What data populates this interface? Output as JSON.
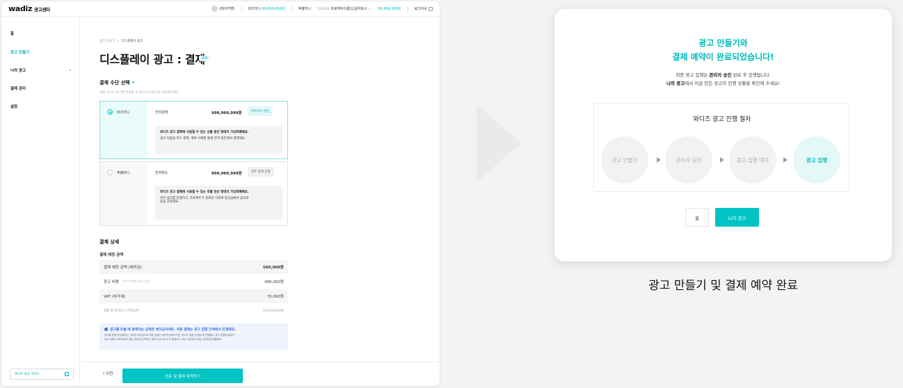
{
  "topbar": {
    "logo": "wadiz",
    "logo_sub": "광고센터",
    "maker": "(메이커명)",
    "biz_money_label": "비즈머니",
    "biz_money_value": "99,999,999원",
    "postpaid_label": "후불머니",
    "project_num": "123456",
    "project_name": "프로젝트이름12글자표시",
    "postpaid_value": "99,999,999원",
    "logout": "로그아웃"
  },
  "sidebar": {
    "items": [
      {
        "label": "홈"
      },
      {
        "label": "광고 만들기"
      },
      {
        "label": "나의 광고"
      },
      {
        "label": "결제 관리"
      },
      {
        "label": "설정"
      }
    ],
    "guide": "와디즈 광고 가이드"
  },
  "main": {
    "breadcrumb_1": "광고 만들기",
    "breadcrumb_sep": ">",
    "breadcrumb_2": "디스플레이 광고",
    "title": "디스플레이 광고 : 결제",
    "step": "4/4",
    "pay_title": "결제 수단 선택",
    "pay_required": "•",
    "pay_desc": "결제 수단은 중간에 변경할 수 없으니 신중하게 선택해주세요.",
    "methods": [
      {
        "name": "비즈머니",
        "label": "잔여금액",
        "amount": "999,999,999원",
        "button": "비즈머니 충전",
        "info_1": "와디즈 광고 결제에 사용할 수 있는 선불 충전 형태의 가상화폐예요.",
        "info_2": "광고 비용을 카드 결제, 계좌 이체를 통해 먼저 충전해서 결제해요."
      },
      {
        "name": "후불머니",
        "label": "잔여한도",
        "amount": "999,999,999원",
        "button": "한도 증액 신청",
        "info_1": "와디즈 광고 결제에 사용할 수 있는 후불 정산 형태의 가상화폐예요.",
        "info_2": "먼저 광고를 진행하고, 프로젝트가 종료된 이후에 정산금에서 광고비",
        "info_3": "용을 차감해요."
      }
    ],
    "detail_title": "결제 상세",
    "detail_sub": "결제 예정 금액",
    "rows": [
      {
        "label": "결제 예정 금액 (예치금)",
        "value": "560,000원"
      },
      {
        "label": "광고 비용",
        "hint": "YYYY-MM-DD (1일)",
        "value": "490,000원"
      },
      {
        "label": "VAT (부가세)",
        "value": "70,000원"
      },
      {
        "label": "결제 후 비즈머니 잔여금액",
        "value": "10,000,000원"
      }
    ],
    "notice_title": "광고를 만들 때 결제되는 금액은 예치금이에요. 최종 결제는 광고 집행 단계에서 진행돼요.",
    "notice_body_1": "광고를 만들 때 결제되는 금액은 예치금으로 최종 결제는 메이커님께서 만든 광고가 집행 단계일 때 진행돼요. 광고 집행에 들어간",
    "notice_body_2": "광고 비용이 예치금보다 많은 경우엔 선택하신 결제 수단으로 추가 결제되고, 적은 경우엔 초과된 금액만큼 환불돼요.",
    "prev": "이전",
    "submit": "완료 및 결제 예약하기"
  },
  "card": {
    "title_1": "광고 만들기와",
    "title_2": "결제 예약이 완료되었습니다!",
    "desc_1a": "최종 광고 집행은 ",
    "desc_1b": "관리자 승인",
    "desc_1c": " 완료 후 진행됩니다.",
    "desc_2a": "나의 광고",
    "desc_2b": "에서 지금 만든 광고의 진행 상황을 확인해 주세요!",
    "process_title": "와디즈 광고 진행 절차",
    "steps": [
      "광고 만들기",
      "관리자 승인",
      "광고 집행 대기",
      "광고 집행"
    ],
    "home_btn": "홈",
    "myad_btn": "나의 광고"
  },
  "caption": "광고 만들기 및 결제 예약 완료",
  "colors": {
    "accent": "#00c4c4",
    "notice": "#3c6fd8"
  }
}
